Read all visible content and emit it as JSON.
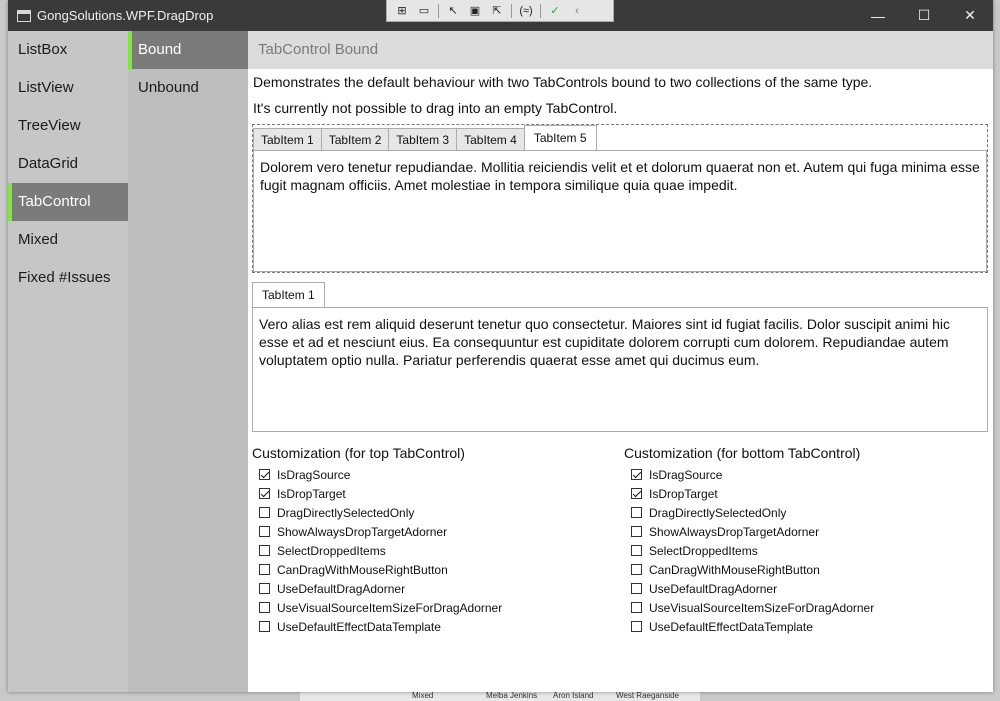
{
  "window": {
    "title": "GongSolutions.WPF.DragDrop",
    "minimize": "—",
    "maximize": "☐",
    "close": "✕"
  },
  "debug_toolbar": {
    "items": [
      "⊞",
      "▭",
      "↖",
      "▣",
      "⇱",
      "(≈)",
      "✓",
      "‹"
    ]
  },
  "nav": {
    "primary": [
      {
        "label": "ListBox"
      },
      {
        "label": "ListView"
      },
      {
        "label": "TreeView"
      },
      {
        "label": "DataGrid"
      },
      {
        "label": "TabControl",
        "selected": true
      },
      {
        "label": "Mixed"
      },
      {
        "label": "Fixed #Issues"
      }
    ],
    "secondary": [
      {
        "label": "Bound",
        "selected": true
      },
      {
        "label": "Unbound"
      }
    ]
  },
  "content": {
    "header": "TabControl Bound",
    "description_1": "Demonstrates the default behaviour with two TabControls bound to two collections of the same type.",
    "description_2": "It's currently not possible to drag into an empty TabControl.",
    "top_tabs": [
      "TabItem 1",
      "TabItem 2",
      "TabItem 3",
      "TabItem 4",
      "TabItem 5"
    ],
    "top_active_tab": 4,
    "top_text": "Dolorem vero tenetur repudiandae. Mollitia reiciendis velit et et dolorum quaerat non et. Autem qui fuga minima esse fugit magnam officiis. Amet molestiae in tempora similique quia quae impedit.",
    "bottom_tabs": [
      "TabItem 1"
    ],
    "bottom_text": "Vero alias est rem aliquid deserunt tenetur quo consectetur. Maiores sint id fugiat facilis. Dolor suscipit animi hic esse et ad et nesciunt eius. Ea consequuntur est cupiditate dolorem corrupti cum dolorem. Repudiandae autem voluptatem optio nulla. Pariatur perferendis quaerat esse amet qui ducimus eum."
  },
  "customization": {
    "top_title": "Customization (for top TabControl)",
    "bottom_title": "Customization (for bottom TabControl)",
    "options": [
      {
        "label": "IsDragSource",
        "checked": true
      },
      {
        "label": "IsDropTarget",
        "checked": true
      },
      {
        "label": "DragDirectlySelectedOnly",
        "checked": false
      },
      {
        "label": "ShowAlwaysDropTargetAdorner",
        "checked": false
      },
      {
        "label": "SelectDroppedItems",
        "checked": false
      },
      {
        "label": "CanDragWithMouseRightButton",
        "checked": false
      },
      {
        "label": "UseDefaultDragAdorner",
        "checked": false
      },
      {
        "label": "UseVisualSourceItemSizeForDragAdorner",
        "checked": false
      },
      {
        "label": "UseDefaultEffectDataTemplate",
        "checked": false
      }
    ]
  },
  "background": {
    "cells": [
      "Mixed",
      "Melba Jenkins",
      "Aron Island",
      "West Raeganside"
    ]
  },
  "colors": {
    "accent": "#7ee63a",
    "titlebar": "#3a3a3a",
    "nav_selected": "#7b7b7b"
  }
}
